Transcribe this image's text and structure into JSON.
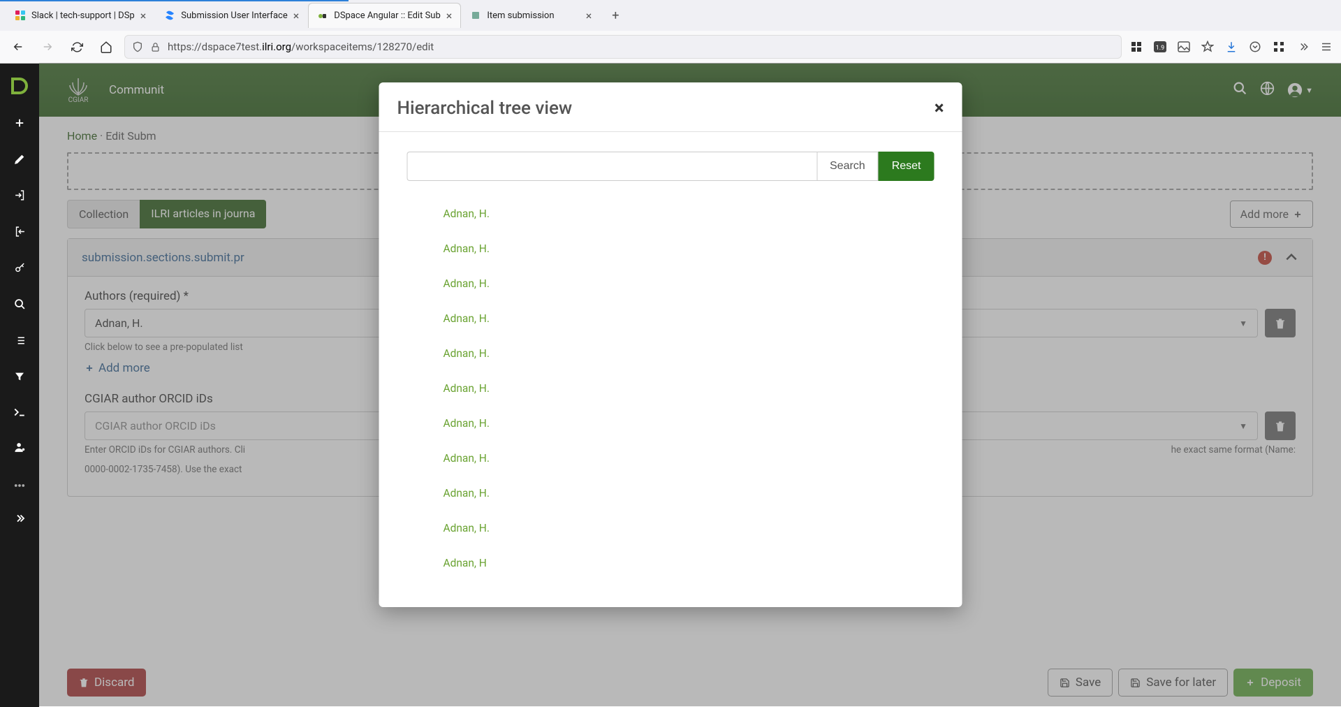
{
  "browser": {
    "tabs": [
      {
        "title": "Slack | tech-support | DSp",
        "favicon": "slack"
      },
      {
        "title": "Submission User Interface",
        "favicon": "confluence"
      },
      {
        "title": "DSpace Angular :: Edit Sub",
        "favicon": "dspace",
        "active": true
      },
      {
        "title": "Item submission",
        "favicon": "dspace2"
      }
    ],
    "url_prefix": "https://dspace7test.",
    "url_domain": "ilri.org",
    "url_path": "/workspaceitems/128270/edit"
  },
  "header": {
    "logo_label": "CGIAR",
    "nav_label": "Communit"
  },
  "breadcrumb": {
    "home": "Home",
    "current": "Edit Subm"
  },
  "collection": {
    "label": "Collection",
    "value": "ILRI articles in journa",
    "add_more": "Add more"
  },
  "section": {
    "title": "submission.sections.submit.pr",
    "authors": {
      "label": "Authors (required) *",
      "value": "Adnan, H.",
      "hint": "Click below to see a pre-populated list",
      "add_more": "Add more"
    },
    "orcid": {
      "label": "CGIAR author ORCID iDs",
      "placeholder": "CGIAR author ORCID iDs",
      "hint_left": "Enter ORCID iDs for CGIAR authors. Cli",
      "hint_right": "he exact same format (Name:",
      "hint_line2": "0000-0002-1735-7458). Use the exact"
    }
  },
  "footer": {
    "discard": "Discard",
    "save": "Save",
    "save_later": "Save for later",
    "deposit": "Deposit"
  },
  "modal": {
    "title": "Hierarchical tree view",
    "search_label": "Search",
    "reset_label": "Reset",
    "items": [
      "Adnan, H.",
      "Adnan, H.",
      "Adnan, H.",
      "Adnan, H.",
      "Adnan, H.",
      "Adnan, H.",
      "Adnan, H.",
      "Adnan, H.",
      "Adnan, H.",
      "Adnan, H.",
      "Adnan, H"
    ]
  }
}
